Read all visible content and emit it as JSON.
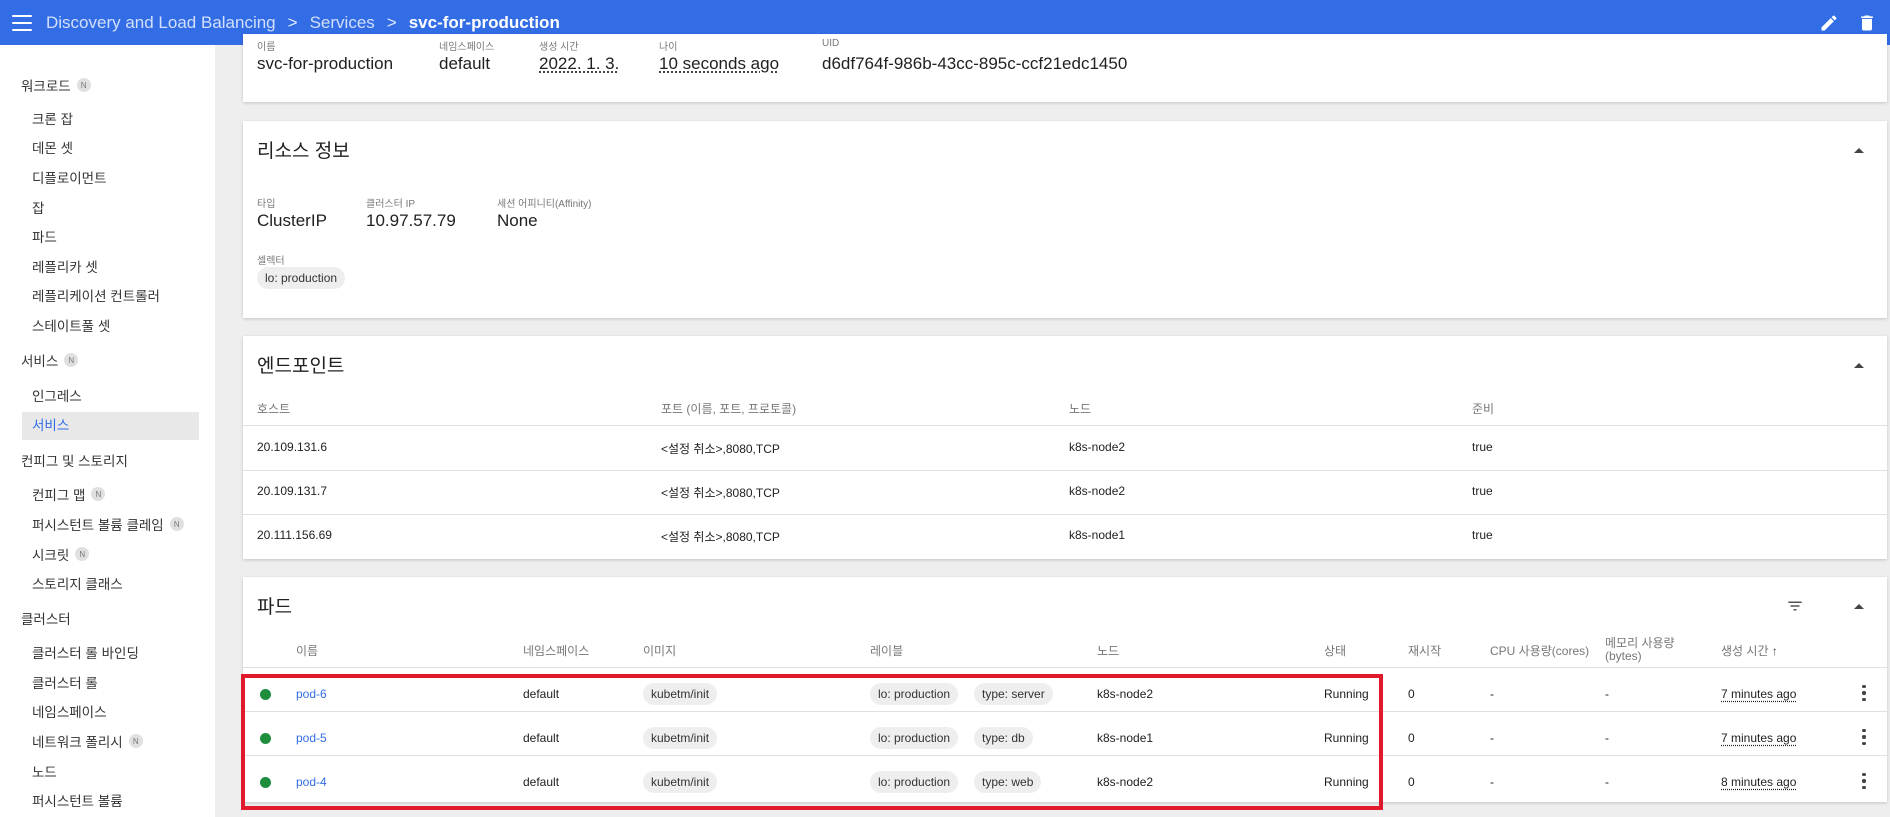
{
  "topbar": {
    "breadcrumbs": [
      "Discovery and Load Balancing",
      "Services",
      "svc-for-production"
    ],
    "separator": ">"
  },
  "sidebar": {
    "sections": [
      {
        "label": "워크로드",
        "badge": "N"
      },
      {
        "label": "서비스",
        "badge": "N"
      },
      {
        "label": "컨피그 및 스토리지",
        "badge": ""
      },
      {
        "label": "클러스터",
        "badge": ""
      }
    ],
    "items": [
      {
        "label": "크론 잡",
        "badge": ""
      },
      {
        "label": "데몬 셋",
        "badge": ""
      },
      {
        "label": "디플로이먼트",
        "badge": ""
      },
      {
        "label": "잡",
        "badge": ""
      },
      {
        "label": "파드",
        "badge": ""
      },
      {
        "label": "레플리카 셋",
        "badge": ""
      },
      {
        "label": "레플리케이션 컨트롤러",
        "badge": ""
      },
      {
        "label": "스테이트풀 셋",
        "badge": ""
      },
      {
        "label": "인그레스",
        "badge": ""
      },
      {
        "label": "서비스",
        "badge": ""
      },
      {
        "label": "컨피그 맵",
        "badge": "N"
      },
      {
        "label": "퍼시스턴트 볼륨 클레임",
        "badge": "N"
      },
      {
        "label": "시크릿",
        "badge": "N"
      },
      {
        "label": "스토리지 클래스",
        "badge": ""
      },
      {
        "label": "클러스터 롤 바인딩",
        "badge": ""
      },
      {
        "label": "클러스터 롤",
        "badge": ""
      },
      {
        "label": "네임스페이스",
        "badge": ""
      },
      {
        "label": "네트워크 폴리시",
        "badge": "N"
      },
      {
        "label": "노드",
        "badge": ""
      },
      {
        "label": "퍼시스턴트 볼륨",
        "badge": ""
      }
    ]
  },
  "metadata": {
    "labels": [
      "이름",
      "네임스페이스",
      "생성 시간",
      "나이",
      "UID"
    ],
    "name": "svc-for-production",
    "namespace": "default",
    "created": "2022. 1. 3.",
    "age": "10 seconds ago",
    "uid": "d6df764f-986b-43cc-895c-ccf21edc1450"
  },
  "resource_info": {
    "title": "리소스 정보",
    "type_label": "타입",
    "type_value": "ClusterIP",
    "cluster_ip_label": "클러스터 IP",
    "cluster_ip_value": "10.97.57.79",
    "affinity_label": "세션 어피니티(Affinity)",
    "affinity_value": "None",
    "selector_label": "셀렉터",
    "selector_value": "lo: production"
  },
  "endpoints": {
    "title": "엔드포인트",
    "headers": [
      "호스트",
      "포트 (이름, 포트, 프로토콜)",
      "노드",
      "준비"
    ],
    "rows": [
      {
        "host": "20.109.131.6",
        "ports": "<설정 취소>,8080,TCP",
        "node": "k8s-node2",
        "ready": "true"
      },
      {
        "host": "20.109.131.7",
        "ports": "<설정 취소>,8080,TCP",
        "node": "k8s-node2",
        "ready": "true"
      },
      {
        "host": "20.111.156.69",
        "ports": "<설정 취소>,8080,TCP",
        "node": "k8s-node1",
        "ready": "true"
      }
    ]
  },
  "pods": {
    "title": "파드",
    "headers": {
      "name": "이름",
      "namespace": "네임스페이스",
      "image": "이미지",
      "labels": "레이블",
      "node": "노드",
      "status": "상태",
      "restarts": "재시작",
      "cpu": "CPU 사용량(cores)",
      "memory_line1": "메모리 사용량",
      "memory_line2": "(bytes)",
      "created": "생성 시간",
      "sort_arrow": "↑"
    },
    "rows": [
      {
        "name": "pod-6",
        "namespace": "default",
        "image": "kubetm/init",
        "label1": "lo: production",
        "label2": "type: server",
        "node": "k8s-node2",
        "status": "Running",
        "restarts": "0",
        "cpu": "-",
        "memory": "-",
        "created": "7 minutes ago"
      },
      {
        "name": "pod-5",
        "namespace": "default",
        "image": "kubetm/init",
        "label1": "lo: production",
        "label2": "type: db",
        "node": "k8s-node1",
        "status": "Running",
        "restarts": "0",
        "cpu": "-",
        "memory": "-",
        "created": "7 minutes ago"
      },
      {
        "name": "pod-4",
        "namespace": "default",
        "image": "kubetm/init",
        "label1": "lo: production",
        "label2": "type: web",
        "node": "k8s-node2",
        "status": "Running",
        "restarts": "0",
        "cpu": "-",
        "memory": "-",
        "created": "8 minutes ago"
      }
    ]
  },
  "colors": {
    "topbar": "#326de6",
    "running": "#1e8e3e",
    "highlight": "#e0192d",
    "link": "#326de6"
  },
  "icons": [
    "menu-icon",
    "edit-icon",
    "delete-icon",
    "chevron-right-icon",
    "collapse-icon",
    "filter-icon",
    "sort-arrow-icon",
    "more-vert-icon",
    "status-running-icon"
  ]
}
